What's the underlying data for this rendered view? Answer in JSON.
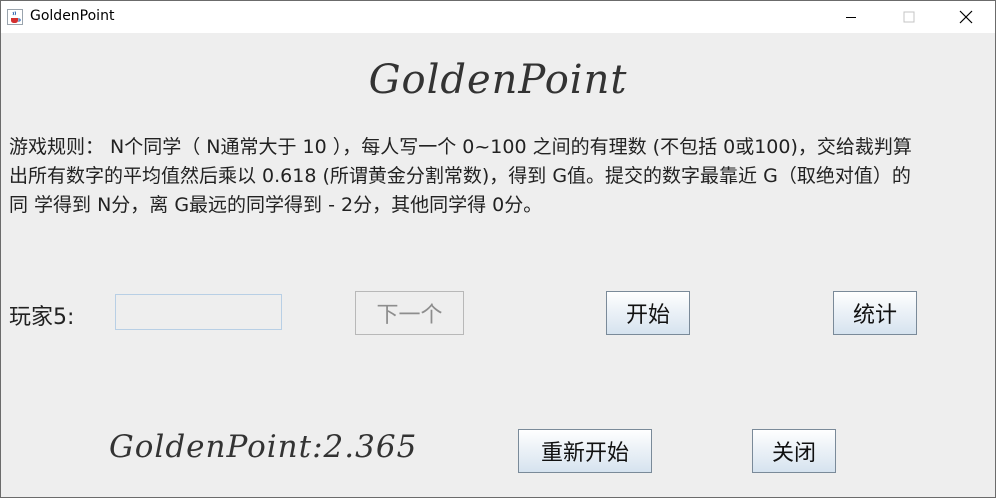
{
  "window": {
    "title": "GoldenPoint",
    "icon": "java-cup-icon"
  },
  "header": {
    "title": "GoldenPoint"
  },
  "rules": {
    "line1": "游戏规则： N个同学（ N通常大于 10 ），每人写一个 0~100 之间的有理数 (不包括 0或100)，交给裁判算",
    "line2": "出所有数字的平均值然后乘以 0.618 (所谓黄金分割常数)，得到 G值。提交的数字最靠近 G（取绝对值）的",
    "line3": "同 学得到 N分，离 G最远的同学得到 -  2分，其他同学得 0分。"
  },
  "player": {
    "label": "玩家5:",
    "input_value": ""
  },
  "buttons": {
    "next": "下一个",
    "start": "开始",
    "stats": "统计",
    "restart": "重新开始",
    "close": "关闭"
  },
  "result": {
    "text": "GoldenPoint:2.365"
  },
  "colors": {
    "background": "#eeeeee",
    "button_border": "#7a8a99",
    "input_border": "#b8cfe5"
  }
}
